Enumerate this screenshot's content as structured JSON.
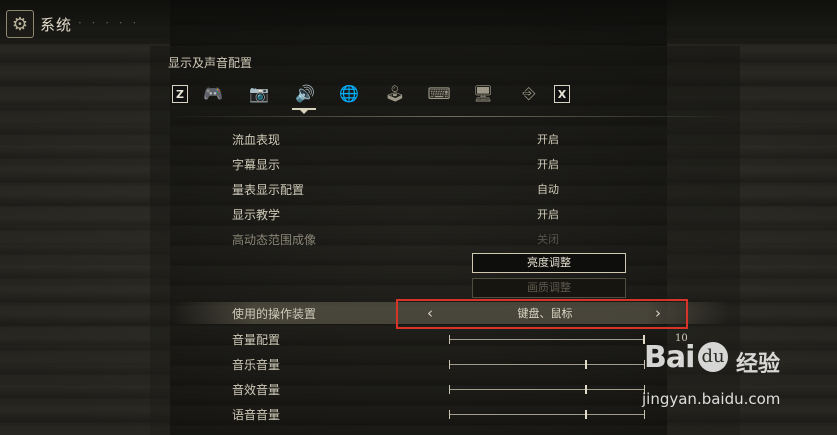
{
  "window": {
    "title": "系统",
    "faint_text": "· · · · ·"
  },
  "section": {
    "heading": "显示及声音配置"
  },
  "tabs": [
    {
      "name": "key-z",
      "glyph": "Z"
    },
    {
      "name": "gamepad",
      "glyph": "🎮"
    },
    {
      "name": "camera",
      "glyph": "📷"
    },
    {
      "name": "display-sound",
      "glyph": "🔊"
    },
    {
      "name": "network",
      "glyph": "🌐"
    },
    {
      "name": "controller-config",
      "glyph": "🕹"
    },
    {
      "name": "keyboard",
      "glyph": "⌨"
    },
    {
      "name": "monitor",
      "glyph": "🖥"
    },
    {
      "name": "exit",
      "glyph": "⎆"
    },
    {
      "name": "key-x",
      "glyph": "X"
    }
  ],
  "settings": [
    {
      "label": "流血表现",
      "value": "开启"
    },
    {
      "label": "字幕显示",
      "value": "开启"
    },
    {
      "label": "量表显示配置",
      "value": "自动"
    },
    {
      "label": "显示教学",
      "value": "开启"
    },
    {
      "label": "高动态范围成像",
      "value": "关闭"
    }
  ],
  "buttons": {
    "brightness": "亮度调整",
    "quality": "画质调整"
  },
  "device": {
    "label": "使用的操作装置",
    "value": "键盘、鼠标",
    "prev": "‹",
    "next": "›"
  },
  "sliders": [
    {
      "label": "音量配置",
      "value": "10",
      "level": 1.0
    },
    {
      "label": "音乐音量",
      "value": "7",
      "level": 0.7
    },
    {
      "label": "音效音量",
      "value": "",
      "level": 0.7
    },
    {
      "label": "语音音量",
      "value": "",
      "level": 0.7
    }
  ],
  "watermark": {
    "brand": "Bai",
    "paw": "du",
    "cn": "经验",
    "url": "jingyan.baidu.com"
  }
}
